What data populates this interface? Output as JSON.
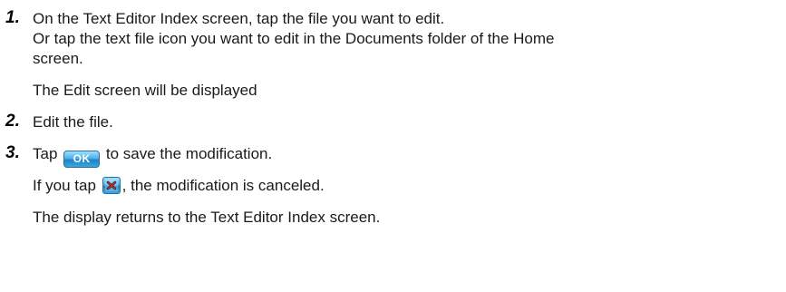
{
  "steps": [
    {
      "number": "1.",
      "lines": [
        "On the Text Editor Index screen, tap the file you want to edit.",
        "Or tap the text file icon you want to edit in the Documents folder of the Home",
        "screen."
      ],
      "result": "The Edit screen will be displayed"
    },
    {
      "number": "2.",
      "text": "Edit the file."
    },
    {
      "number": "3.",
      "text_before_icon": "Tap",
      "ok_icon_label": "OK",
      "text_after_icon": "to save the modification.",
      "cancel_before_icon": "If you tap",
      "cancel_after_icon": ", the modification is canceled.",
      "result": "The display returns to the Text Editor Index screen."
    }
  ],
  "icons": {
    "ok": "ok-button-icon",
    "cancel": "close-x-icon",
    "accent_color": "#1d83c6"
  }
}
